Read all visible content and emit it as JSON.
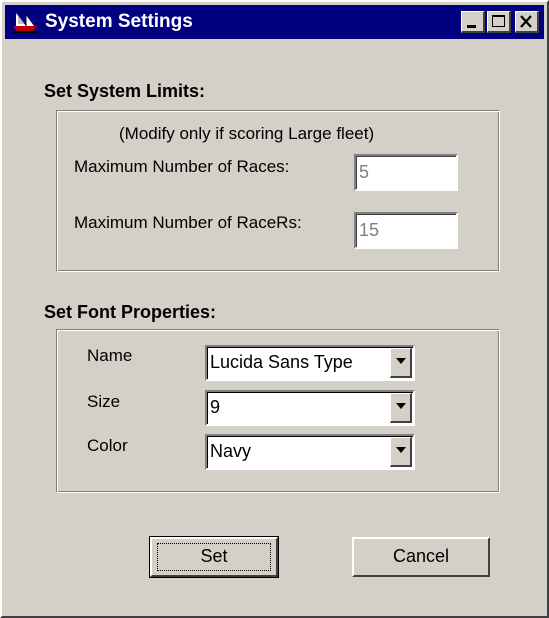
{
  "window": {
    "title": "System Settings",
    "icon": "sailboat-icon",
    "controls": [
      "minimize-icon",
      "maximize-icon",
      "close-icon"
    ]
  },
  "limits": {
    "section_label": "Set System Limits:",
    "hint": "(Modify only if scoring Large fleet)",
    "max_races_label": "Maximum Number of Races:",
    "max_races_value": "5",
    "max_racers_label": "Maximum Number of RaceRs:",
    "max_racers_value": "15"
  },
  "font": {
    "section_label": "Set Font Properties:",
    "name_label": "Name",
    "name_value": "Lucida Sans Type",
    "size_label": "Size",
    "size_value": "9",
    "color_label": "Color",
    "color_value": "Navy"
  },
  "buttons": {
    "set_label": "Set",
    "cancel_label": "Cancel"
  },
  "colors": {
    "titlebar": "#000080",
    "face": "#d4d0c8",
    "disabled_text": "#808080"
  }
}
